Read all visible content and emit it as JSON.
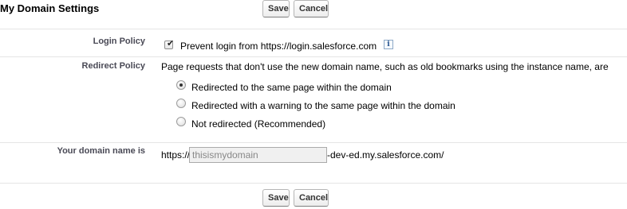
{
  "section": {
    "title": "My Domain Settings"
  },
  "buttons": {
    "save_label": "Save",
    "cancel_label": "Cancel"
  },
  "login_policy": {
    "label": "Login Policy",
    "checkbox_label": "Prevent login from https://login.salesforce.com",
    "checked": true,
    "info_icon": "i"
  },
  "redirect_policy": {
    "label": "Redirect Policy",
    "description": "Page requests that don't use the new domain name, such as old bookmarks using the instance name, are",
    "options": [
      {
        "label": "Redirected to the same page within the domain",
        "selected": true
      },
      {
        "label": "Redirected with a warning to the same page within the domain",
        "selected": false
      },
      {
        "label": "Not redirected (Recommended)",
        "selected": false
      }
    ]
  },
  "domain": {
    "label": "Your domain name is",
    "prefix": "https://",
    "value": "thisismydomain",
    "suffix": "-dev-ed.my.salesforce.com/"
  },
  "icons": {
    "checkbox_tick": "check-icon",
    "info": "info-icon"
  }
}
